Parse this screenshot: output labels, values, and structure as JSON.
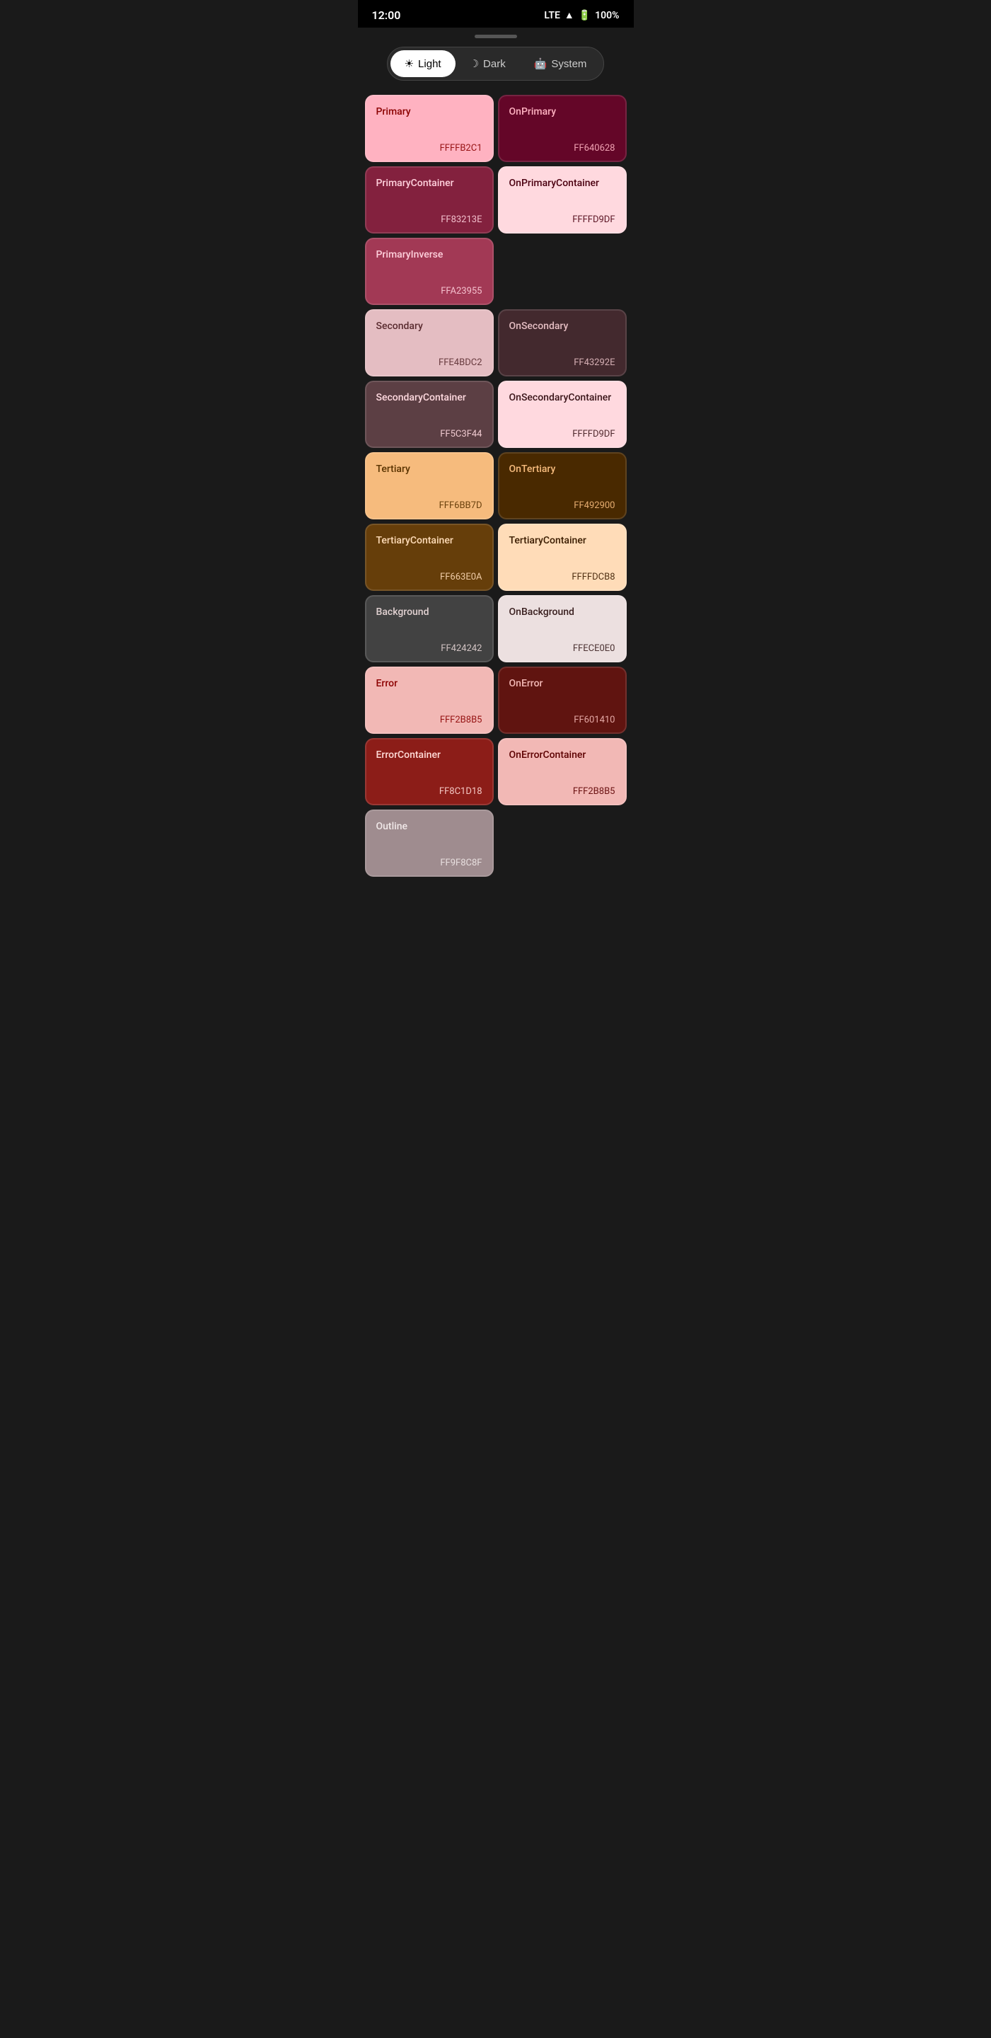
{
  "statusBar": {
    "time": "12:00",
    "signal": "LTE",
    "battery": "100%"
  },
  "themeSelector": {
    "buttons": [
      {
        "id": "light",
        "label": "Light",
        "icon": "☀",
        "active": true
      },
      {
        "id": "dark",
        "label": "Dark",
        "icon": "☽",
        "active": false
      },
      {
        "id": "system",
        "label": "System",
        "icon": "🤖",
        "active": false
      }
    ]
  },
  "colors": [
    {
      "name": "Primary",
      "hex": "FFFFB2C1",
      "bg": "#FFB2C1",
      "textColor": "#8B0000"
    },
    {
      "name": "OnPrimary",
      "hex": "FF640628",
      "bg": "#640628",
      "textColor": "#FFB2C1"
    },
    {
      "name": "PrimaryContainer",
      "hex": "FF83213E",
      "bg": "#83213E",
      "textColor": "#FFD0DC"
    },
    {
      "name": "OnPrimaryContainer",
      "hex": "FFFFD9DF",
      "bg": "#FFD9DF",
      "textColor": "#4a0010"
    },
    {
      "name": "PrimaryInverse",
      "hex": "FFA23955",
      "bg": "#A23955",
      "textColor": "#FFD0DC",
      "fullWidth": false
    },
    {
      "name": "",
      "hex": "",
      "bg": "transparent",
      "textColor": "transparent",
      "empty": true
    },
    {
      "name": "Secondary",
      "hex": "FFE4BDC2",
      "bg": "#E4BDC2",
      "textColor": "#5a2c30"
    },
    {
      "name": "OnSecondary",
      "hex": "FF43292E",
      "bg": "#43292E",
      "textColor": "#E4BDC2"
    },
    {
      "name": "SecondaryContainer",
      "hex": "FF5C3F44",
      "bg": "#5C3F44",
      "textColor": "#FFD9DF"
    },
    {
      "name": "OnSecondaryContainer",
      "hex": "FFFFD9DF",
      "bg": "#FFD9DF",
      "textColor": "#3a1519"
    },
    {
      "name": "Tertiary",
      "hex": "FFF6BB7D",
      "bg": "#F6BB7D",
      "textColor": "#5a3300"
    },
    {
      "name": "OnTertiary",
      "hex": "FF492900",
      "bg": "#492900",
      "textColor": "#F6BB7D"
    },
    {
      "name": "TertiaryContainer",
      "hex": "FF663E0A",
      "bg": "#663E0A",
      "textColor": "#FFDCB8"
    },
    {
      "name": "TertiaryContainer",
      "hex": "FFFFDCB8",
      "bg": "#FFDCB8",
      "textColor": "#3a1c00"
    },
    {
      "name": "Background",
      "hex": "FF424242",
      "bg": "#424242",
      "textColor": "#e0d0d0"
    },
    {
      "name": "OnBackground",
      "hex": "FFECE0E0",
      "bg": "#ECE0E0",
      "textColor": "#3a2020"
    },
    {
      "name": "Error",
      "hex": "FFF2B8B5",
      "bg": "#F2B8B5",
      "textColor": "#8c0000"
    },
    {
      "name": "OnError",
      "hex": "FF601410",
      "bg": "#601410",
      "textColor": "#F2B8B5"
    },
    {
      "name": "ErrorContainer",
      "hex": "FF8C1D18",
      "bg": "#8C1D18",
      "textColor": "#FFDAD6"
    },
    {
      "name": "OnErrorContainer",
      "hex": "FFF2B8B5",
      "bg": "#F2B8B5",
      "textColor": "#5c0000"
    },
    {
      "name": "Outline",
      "hex": "FF9F8C8F",
      "bg": "#9F8C8F",
      "textColor": "#f0e8e8",
      "fullWidth": false
    }
  ]
}
